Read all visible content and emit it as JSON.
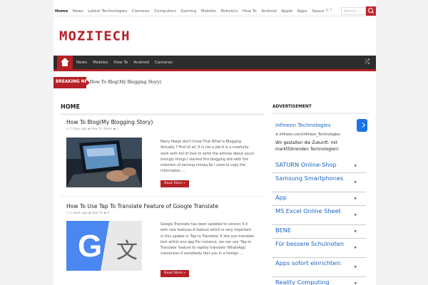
{
  "topbar": {
    "links": [
      "Home",
      "News",
      "Latest Technologies",
      "Cameras",
      "Computers",
      "Gaming",
      "Mobiles",
      "Robotics",
      "How To",
      "Android",
      "Apple",
      "Apps",
      "Space"
    ],
    "active": "Home",
    "search_placeholder": "Search..."
  },
  "brand": {
    "logo": "MOZITECH",
    "color": "#b52126"
  },
  "mainnav": {
    "items": [
      "News",
      "Mobiles",
      "How To",
      "Android",
      "Cameras"
    ]
  },
  "breaking": {
    "label": "BREAKING NEWS",
    "text": "How To Blog(My Blogging Story)"
  },
  "content": {
    "title": "HOME",
    "posts": [
      {
        "title": "How To Blog(My Blogging Story)",
        "date": "7 days ago",
        "categories": "How To, News",
        "comments": "1",
        "excerpt": "Many Peeps don't know That What is Blogging Actually ? First of all, It is not a Job.It is a creativity work with full of love to write the articles about yours lovingly things.I started this blogging site with the intention of earning money.So I used to copy the information ...",
        "read_more": "Read More »",
        "thumb": "laptop-typing"
      },
      {
        "title": "How To Use Tap To Translate Feature of Google Translate",
        "date": "1 week ago",
        "categories": "How To",
        "comments": "0",
        "excerpt": "Google Translate has been updated to version 5.0 with new features.A feature which is very important in this update is 'Tap to Translate'.It lets you translate text within any app.For instance, we can use 'Tap to Translate' feature to rapidly translate 'WhatsApp' conversion if somebody text you in a foreign ...",
        "read_more": "Read More »",
        "thumb": "google-translate-logo"
      }
    ]
  },
  "sidebar": {
    "title": "ADVERTISEMENT",
    "ad": {
      "headline": "Infineon Technologies",
      "url": "infineon.com/infineon_Technologies",
      "body": "Wir gestalten die Zukunft: mit marktführenden Technologien!",
      "links": [
        "SATURN Online-Shop",
        "Samsung Smartphones",
        "App",
        "MS Excel Online Sheet",
        "BENE",
        "Für bessere Schulnoten",
        "Apps sofort einrichten:",
        "Reality Computing"
      ]
    }
  }
}
